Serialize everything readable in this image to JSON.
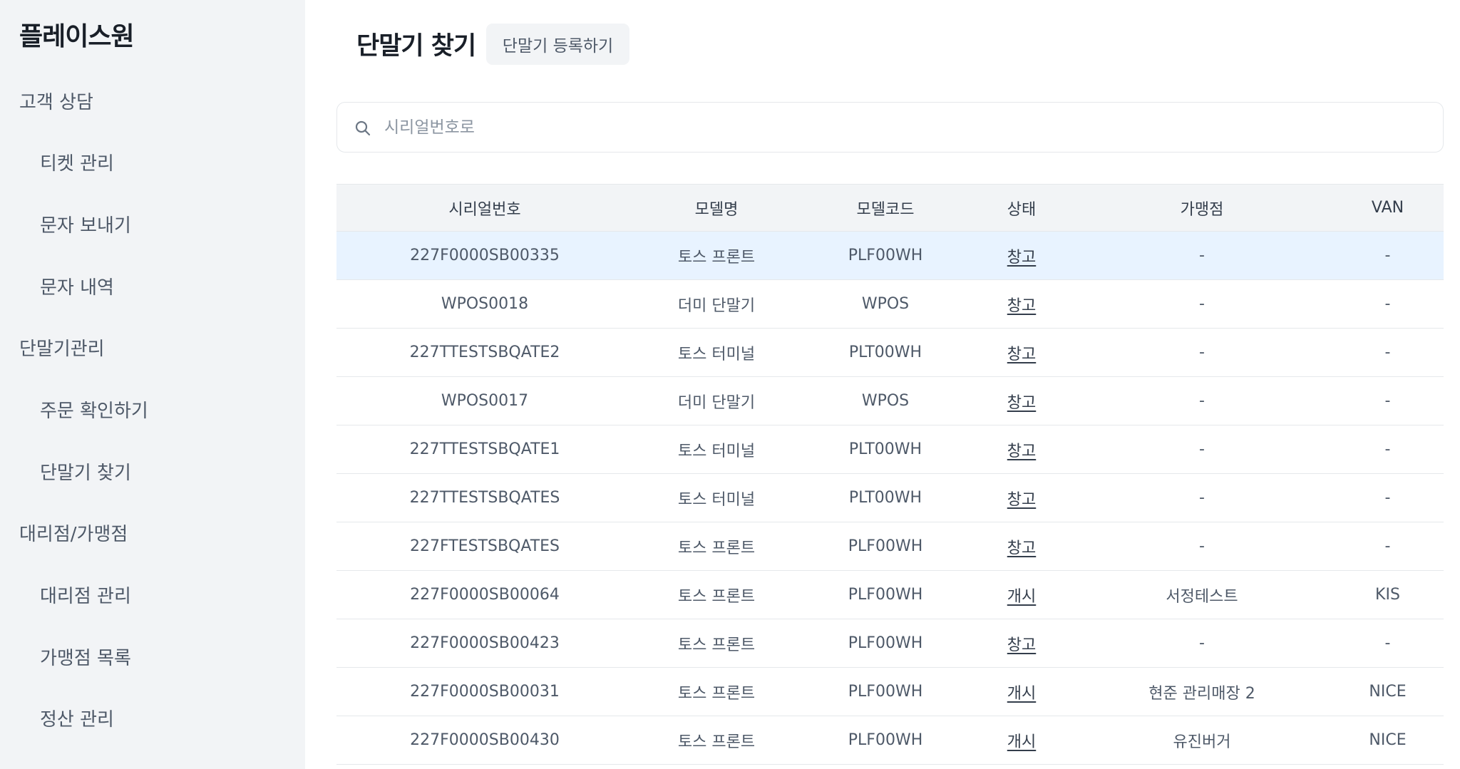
{
  "sidebar": {
    "brand": "플레이스원",
    "groups": [
      {
        "label": "고객 상담",
        "items": [
          "티켓 관리",
          "문자 보내기",
          "문자 내역"
        ]
      },
      {
        "label": "단말기관리",
        "items": [
          "주문 확인하기",
          "단말기 찾기"
        ]
      },
      {
        "label": "대리점/가맹점",
        "items": [
          "대리점 관리",
          "가맹점 목록",
          "정산 관리"
        ]
      }
    ]
  },
  "header": {
    "title": "단말기 찾기",
    "register_button": "단말기 등록하기"
  },
  "search": {
    "placeholder": "시리얼번호로",
    "value": ""
  },
  "table": {
    "columns": [
      "시리얼번호",
      "모델명",
      "모델코드",
      "상태",
      "가맹점",
      "VAN"
    ],
    "selected_row": 0,
    "rows": [
      [
        "227F0000SB00335",
        "토스 프론트",
        "PLF00WH",
        "창고",
        "-",
        "-"
      ],
      [
        "WPOS0018",
        "더미 단말기",
        "WPOS",
        "창고",
        "-",
        "-"
      ],
      [
        "227TTESTSBQATE2",
        "토스 터미널",
        "PLT00WH",
        "창고",
        "-",
        "-"
      ],
      [
        "WPOS0017",
        "더미 단말기",
        "WPOS",
        "창고",
        "-",
        "-"
      ],
      [
        "227TTESTSBQATE1",
        "토스 터미널",
        "PLT00WH",
        "창고",
        "-",
        "-"
      ],
      [
        "227TTESTSBQATES",
        "토스 터미널",
        "PLT00WH",
        "창고",
        "-",
        "-"
      ],
      [
        "227FTESTSBQATES",
        "토스 프론트",
        "PLF00WH",
        "창고",
        "-",
        "-"
      ],
      [
        "227F0000SB00064",
        "토스 프론트",
        "PLF00WH",
        "개시",
        "서정테스트",
        "KIS"
      ],
      [
        "227F0000SB00423",
        "토스 프론트",
        "PLF00WH",
        "창고",
        "-",
        "-"
      ],
      [
        "227F0000SB00031",
        "토스 프론트",
        "PLF00WH",
        "개시",
        "현준 관리매장 2",
        "NICE"
      ],
      [
        "227F0000SB00430",
        "토스 프론트",
        "PLF00WH",
        "개시",
        "유진버거",
        "NICE"
      ]
    ]
  }
}
